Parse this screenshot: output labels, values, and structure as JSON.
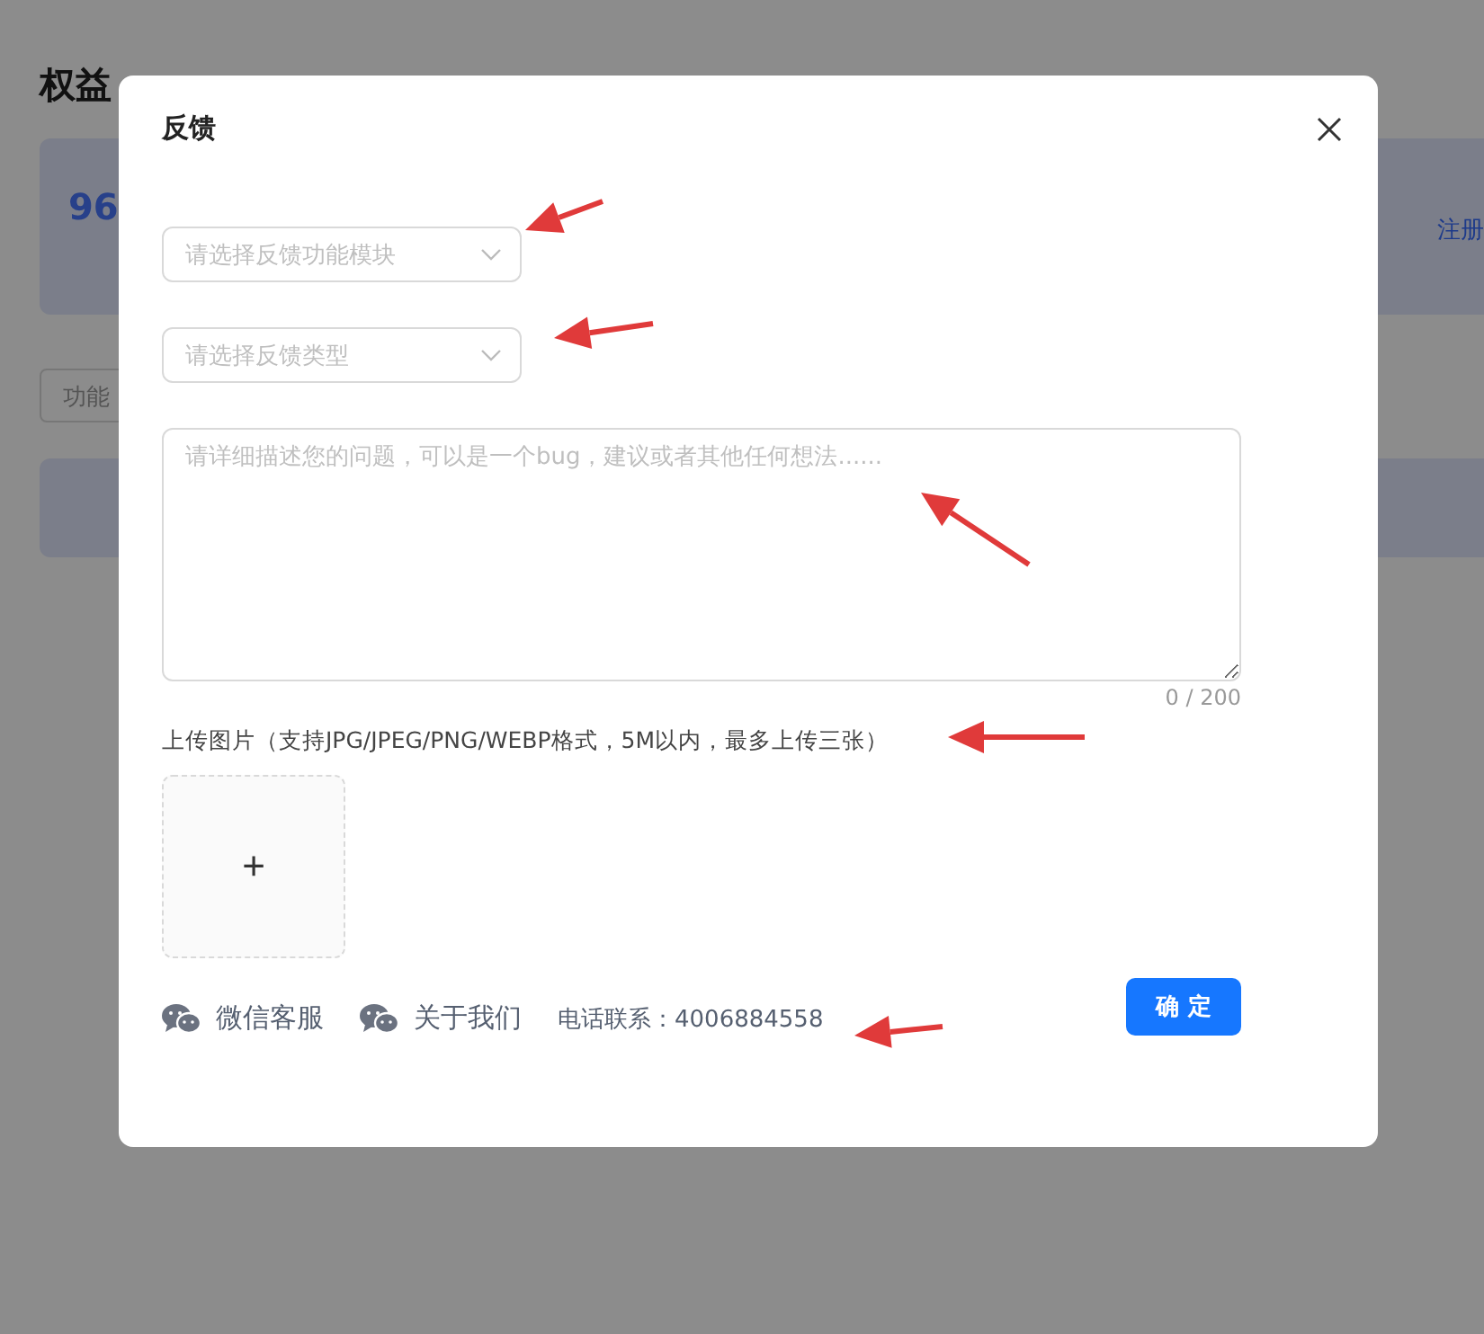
{
  "page": {
    "title": "权益",
    "summary_value": "96",
    "link": "注册",
    "filter": "功能"
  },
  "dialog": {
    "title": "反馈",
    "selects": [
      {
        "placeholder": "请选择反馈功能模块"
      },
      {
        "placeholder": "请选择反馈类型"
      }
    ],
    "description": {
      "placeholder": "请详细描述您的问题，可以是一个bug，建议或者其他任何想法......",
      "counter": "0 / 200"
    },
    "upload": {
      "label": "上传图片（支持JPG/JPEG/PNG/WEBP格式，5M以内，最多上传三张）",
      "add": "+"
    },
    "footer": {
      "links": [
        {
          "label": "微信客服"
        },
        {
          "label": "关于我们"
        }
      ],
      "phone": "电话联系：4006884558"
    },
    "confirm": "确 定"
  }
}
